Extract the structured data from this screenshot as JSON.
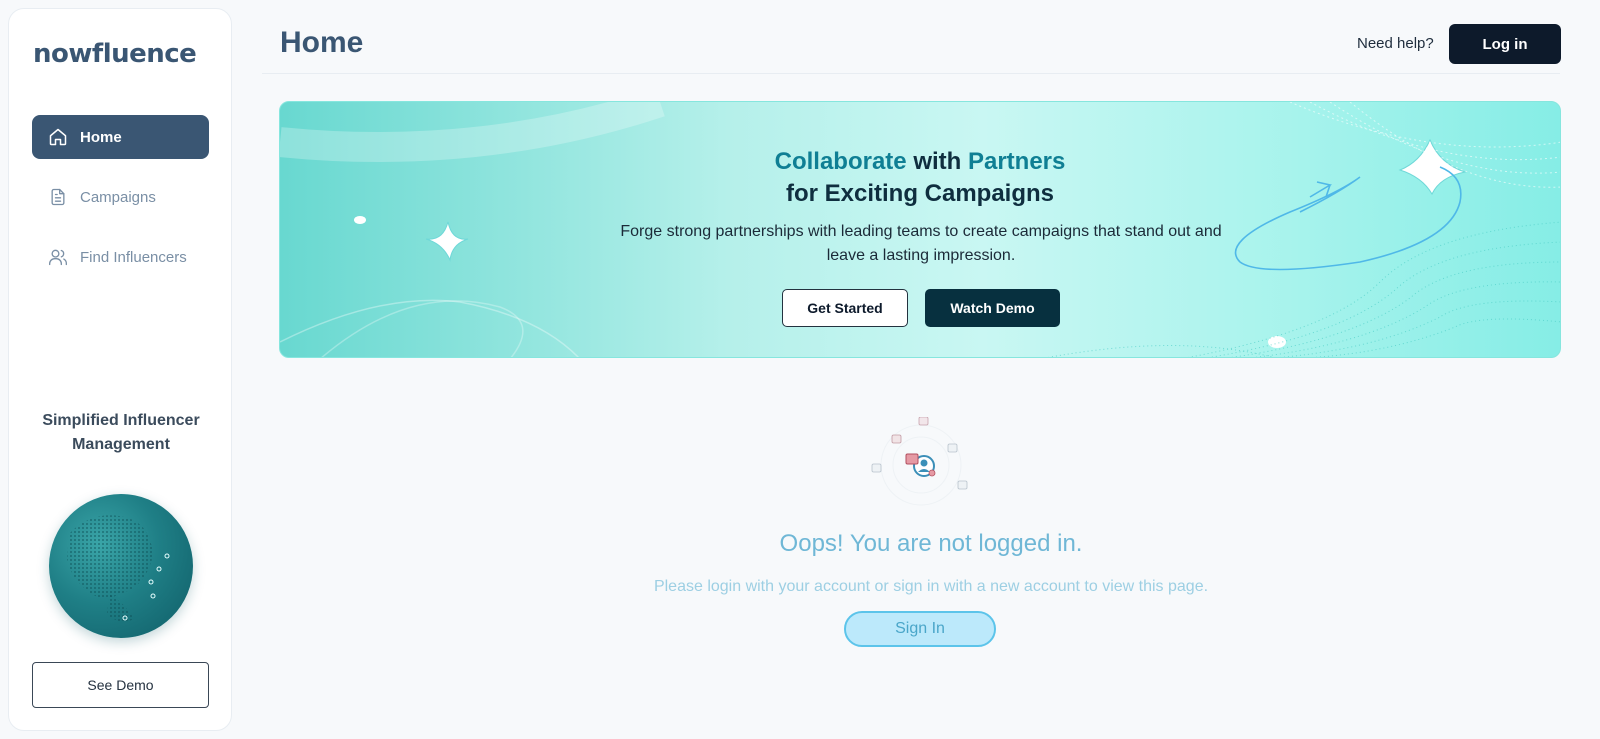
{
  "sidebar": {
    "brand": "nowfluence",
    "items": [
      {
        "label": "Home",
        "icon": "home-icon",
        "active": true
      },
      {
        "label": "Campaigns",
        "icon": "document-icon",
        "active": false
      },
      {
        "label": "Find Influencers",
        "icon": "users-icon",
        "active": false
      }
    ],
    "tagline": "Simplified Influencer Management",
    "see_demo_label": "See Demo"
  },
  "header": {
    "title": "Home",
    "help_label": "Need help?",
    "login_label": "Log in"
  },
  "banner": {
    "title_part1": "Collaborate",
    "title_part2": " with ",
    "title_part3": "Partners",
    "title_line2": "for Exciting Campaigns",
    "subtitle": "Forge strong partnerships with leading teams to create campaigns that stand out and leave a lasting impression.",
    "get_started_label": "Get Started",
    "watch_demo_label": "Watch Demo"
  },
  "empty_state": {
    "title": "Oops! You are not logged in.",
    "message": "Please login with your account or sign in with a new account to view this page.",
    "sign_in_label": "Sign In"
  },
  "colors": {
    "primary": "#3a5673",
    "dark": "#0d1a2b",
    "banner_accent": "#0f7f94",
    "empty_state_text": "#6fb7d6"
  }
}
